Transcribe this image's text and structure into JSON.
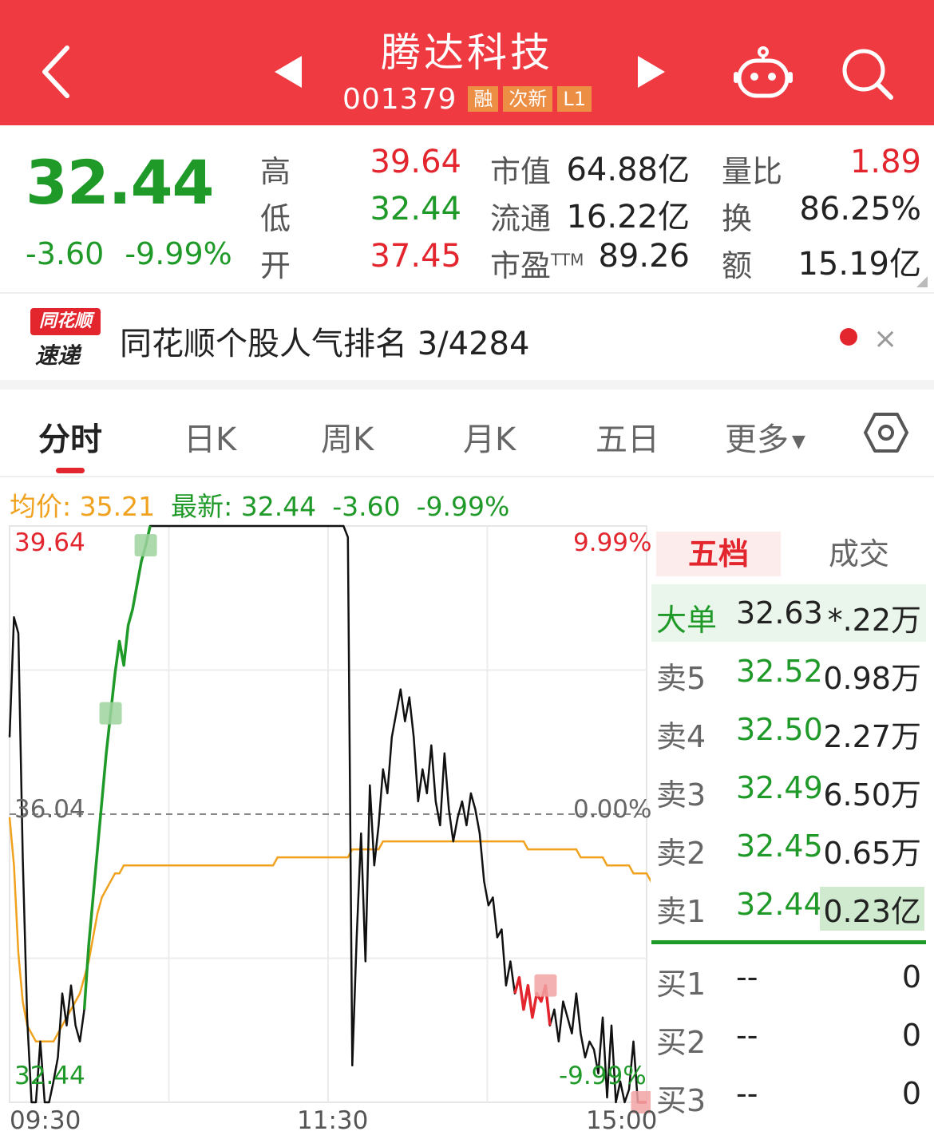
{
  "header": {
    "title": "腾达科技",
    "code": "001379",
    "tags": [
      "融",
      "次新",
      "L1"
    ]
  },
  "quote": {
    "price": "32.44",
    "change": "-3.60",
    "change_pct": "-9.99%",
    "stats": [
      {
        "label": "高",
        "value": "39.64"
      },
      {
        "label": "低",
        "value": "32.44"
      },
      {
        "label": "开",
        "value": "37.45"
      }
    ],
    "stats2": [
      {
        "label": "市值",
        "value": "64.88亿"
      },
      {
        "label": "流通",
        "value": "16.22亿"
      },
      {
        "label": "市盈",
        "sup": "TTM",
        "value": "89.26"
      }
    ],
    "stats3": [
      {
        "label": "量比",
        "value": "1.89"
      },
      {
        "label": "换",
        "value": "86.25%"
      },
      {
        "label": "额",
        "value": "15.19亿"
      }
    ]
  },
  "news": {
    "logo_top": "同花顺",
    "logo_bottom": "速递",
    "text": "同花顺个股人气排名 3/4284",
    "close": "×"
  },
  "tabs": [
    "分时",
    "日K",
    "周K",
    "月K",
    "五日",
    "更多"
  ],
  "info": {
    "avg_label": "均价: 35.21",
    "latest_label": "最新: 32.44",
    "change": "-3.60",
    "change_pct": "-9.99%"
  },
  "chart_data": {
    "type": "line",
    "y_labels_left": [
      "39.64",
      "36.04",
      "32.44"
    ],
    "y_labels_right": [
      "9.99%",
      "0.00%",
      "-9.99%"
    ],
    "x_labels": [
      "09:30",
      "11:30",
      "15:00"
    ],
    "ylim": [
      32.44,
      39.64
    ],
    "series": [
      {
        "name": "最新",
        "color": "#111111",
        "values": [
          37.0,
          38.5,
          38.3,
          35.5,
          33.5,
          32.44,
          32.44,
          33.2,
          32.44,
          32.44,
          32.7,
          33.0,
          33.8,
          33.4,
          33.9,
          33.4,
          33.2,
          33.6,
          34.4,
          35.0,
          35.6,
          36.2,
          36.8,
          37.3,
          37.8,
          38.2,
          37.9,
          38.4,
          38.6,
          38.9,
          39.2,
          39.4,
          39.64,
          39.64,
          39.64,
          39.64,
          39.64,
          39.64,
          39.64,
          39.64,
          39.64,
          39.64,
          39.64,
          39.64,
          39.64,
          39.64,
          39.64,
          39.64,
          39.64,
          39.64,
          39.64,
          39.64,
          39.64,
          39.64,
          39.64,
          39.64,
          39.64,
          39.64,
          39.64,
          39.64,
          39.64,
          39.64,
          39.64,
          39.64,
          39.64,
          39.64,
          39.64,
          39.64,
          39.64,
          39.64,
          39.64,
          39.64,
          39.64,
          39.64,
          39.64,
          39.64,
          39.64,
          39.5,
          32.9,
          34.5,
          35.8,
          34.2,
          36.4,
          35.4,
          35.9,
          36.6,
          36.3,
          37.0,
          37.3,
          37.6,
          37.2,
          37.5,
          37.0,
          36.2,
          36.6,
          36.3,
          36.9,
          36.2,
          35.9,
          36.8,
          36.1,
          35.7,
          36.0,
          36.2,
          35.9,
          36.3,
          36.1,
          35.8,
          35.2,
          34.9,
          35.0,
          34.5,
          34.6,
          33.9,
          34.2,
          33.8,
          34.0,
          33.6,
          33.9,
          33.5,
          33.8,
          33.7,
          33.9,
          33.4,
          33.6,
          33.2,
          33.7,
          33.5,
          33.3,
          33.8,
          33.3,
          33.0,
          33.2,
          33.1,
          32.8,
          33.5,
          32.5,
          33.4,
          32.44,
          32.7,
          32.44,
          32.6,
          33.2,
          32.44,
          32.44,
          32.44
        ],
        "avg_color": "#f0a21f",
        "avg_values": [
          36.0,
          35.4,
          34.3,
          33.7,
          33.4,
          33.3,
          33.2,
          33.2,
          33.2,
          33.2,
          33.2,
          33.3,
          33.4,
          33.5,
          33.6,
          33.7,
          33.8,
          34.0,
          34.2,
          34.5,
          34.8,
          35.0,
          35.1,
          35.2,
          35.3,
          35.3,
          35.4,
          35.4,
          35.4,
          35.4,
          35.4,
          35.4,
          35.4,
          35.4,
          35.4,
          35.4,
          35.4,
          35.4,
          35.4,
          35.4,
          35.4,
          35.4,
          35.4,
          35.4,
          35.4,
          35.4,
          35.4,
          35.4,
          35.4,
          35.4,
          35.4,
          35.4,
          35.4,
          35.4,
          35.4,
          35.4,
          35.4,
          35.4,
          35.4,
          35.4,
          35.4,
          35.5,
          35.5,
          35.5,
          35.5,
          35.5,
          35.5,
          35.5,
          35.5,
          35.5,
          35.5,
          35.5,
          35.5,
          35.5,
          35.5,
          35.5,
          35.5,
          35.5,
          35.6,
          35.6,
          35.6,
          35.6,
          35.6,
          35.6,
          35.6,
          35.7,
          35.7,
          35.7,
          35.7,
          35.7,
          35.7,
          35.7,
          35.7,
          35.7,
          35.7,
          35.7,
          35.7,
          35.7,
          35.7,
          35.7,
          35.7,
          35.7,
          35.7,
          35.7,
          35.7,
          35.7,
          35.7,
          35.7,
          35.7,
          35.7,
          35.7,
          35.7,
          35.7,
          35.7,
          35.7,
          35.7,
          35.7,
          35.7,
          35.6,
          35.6,
          35.6,
          35.6,
          35.6,
          35.6,
          35.6,
          35.6,
          35.6,
          35.6,
          35.6,
          35.6,
          35.5,
          35.5,
          35.5,
          35.5,
          35.5,
          35.5,
          35.4,
          35.4,
          35.4,
          35.4,
          35.4,
          35.4,
          35.3,
          35.3,
          35.3,
          35.3,
          35.2,
          35.21,
          35.21
        ]
      }
    ]
  },
  "orderbook": {
    "tabs": [
      "五档",
      "成交"
    ],
    "big": {
      "label": "大单",
      "price": "32.63",
      "vol": "*.22万"
    },
    "asks": [
      {
        "label": "卖5",
        "price": "32.52",
        "vol": "0.98万"
      },
      {
        "label": "卖4",
        "price": "32.50",
        "vol": "2.27万"
      },
      {
        "label": "卖3",
        "price": "32.49",
        "vol": "6.50万"
      },
      {
        "label": "卖2",
        "price": "32.45",
        "vol": "0.65万"
      },
      {
        "label": "卖1",
        "price": "32.44",
        "vol": "0.23亿"
      }
    ],
    "bids": [
      {
        "label": "买1",
        "price": "--",
        "vol": "0"
      },
      {
        "label": "买2",
        "price": "--",
        "vol": "0"
      },
      {
        "label": "买3",
        "price": "--",
        "vol": "0"
      }
    ]
  },
  "colors": {
    "brand": "#ef3a42",
    "up": "#e3262e",
    "down": "#1f9a29",
    "avg": "#f0a21f"
  }
}
